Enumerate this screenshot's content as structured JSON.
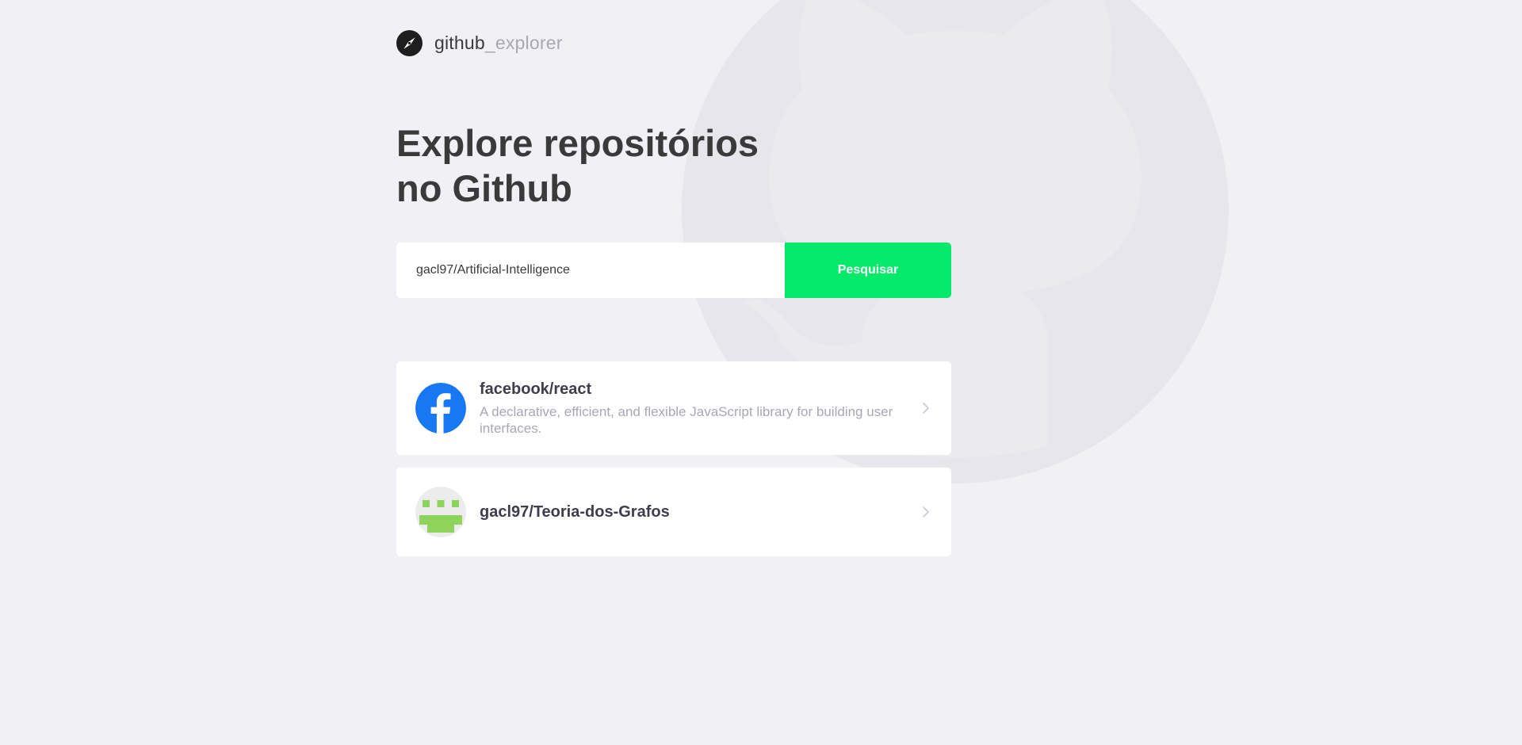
{
  "header": {
    "logo_icon": "compass-icon",
    "brand_main": "github",
    "brand_muted": "_explorer"
  },
  "title": {
    "line1": "Explore repositórios",
    "line2": "no Github"
  },
  "search": {
    "value": "gacl97/Artificial-Intelligence",
    "button_label": "Pesquisar",
    "button_color": "#04e96a"
  },
  "repositories": [
    {
      "name": "facebook/react",
      "description": "A declarative, efficient, and flexible JavaScript library for building user interfaces.",
      "avatar_icon": "facebook-logo-icon",
      "avatar_color": "#1877f2",
      "chevron_icon": "chevron-right-icon"
    },
    {
      "name": "gacl97/Teoria-dos-Grafos",
      "description": "",
      "avatar_icon": "identicon-avatar-icon",
      "avatar_color": "#8ed45c",
      "chevron_icon": "chevron-right-icon"
    }
  ],
  "colors": {
    "background": "#f0f0f5",
    "title": "#3a3a3a",
    "muted": "#a8a8b3",
    "card": "#ffffff"
  },
  "background_decoration": "octocat-silhouette-icon"
}
